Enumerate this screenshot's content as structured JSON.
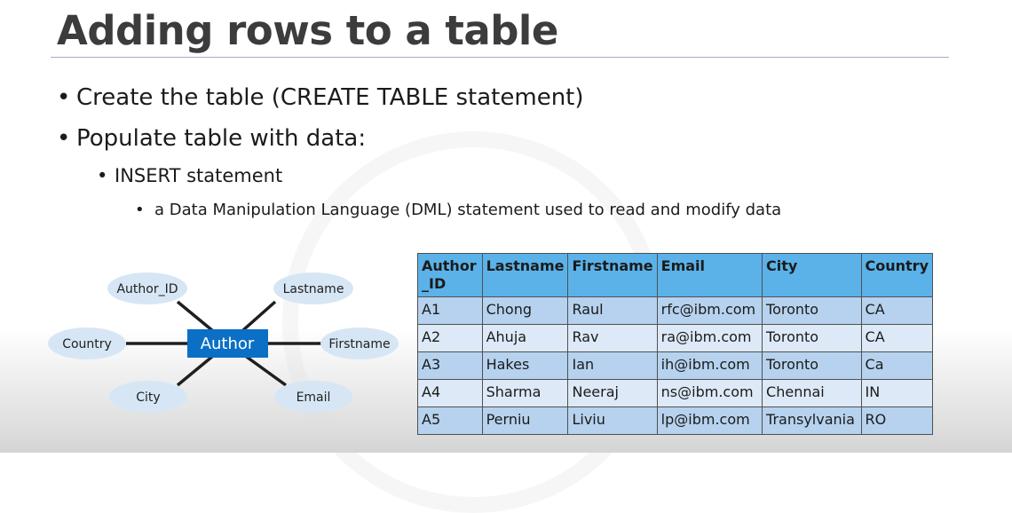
{
  "slide": {
    "title": "Adding rows to a table",
    "bullets": [
      {
        "text": "Create the table (CREATE TABLE statement)"
      },
      {
        "text": "Populate table with data:"
      },
      {
        "text": "INSERT statement"
      },
      {
        "text": "a Data Manipulation Language (DML) statement used to read and modify data"
      }
    ]
  },
  "diagram": {
    "entity": "Author",
    "attributes": [
      "Author_ID",
      "Lastname",
      "Country",
      "Firstname",
      "City",
      "Email"
    ]
  },
  "table": {
    "headers": [
      "Author\n_ID",
      "Lastname",
      "Firstname",
      "Email",
      "City",
      "Country"
    ],
    "rows": [
      [
        "A1",
        "Chong",
        "Raul",
        "rfc@ibm.com",
        "Toronto",
        "CA"
      ],
      [
        "A2",
        "Ahuja",
        "Rav",
        "ra@ibm.com",
        "Toronto",
        "CA"
      ],
      [
        "A3",
        "Hakes",
        "Ian",
        "ih@ibm.com",
        "Toronto",
        "Ca"
      ],
      [
        "A4",
        "Sharma",
        "Neeraj",
        "ns@ibm.com",
        "Chennai",
        "IN"
      ],
      [
        "A5",
        "Perniu",
        "Liviu",
        "lp@ibm.com",
        "Transylvania",
        "RO"
      ]
    ]
  },
  "colors": {
    "entity_fill": "#0b6fc6",
    "attribute_fill": "#d6e6f4",
    "header_fill": "#5ab2e8",
    "row_dark": "#b6d2ee",
    "row_light": "#dde9f7"
  }
}
